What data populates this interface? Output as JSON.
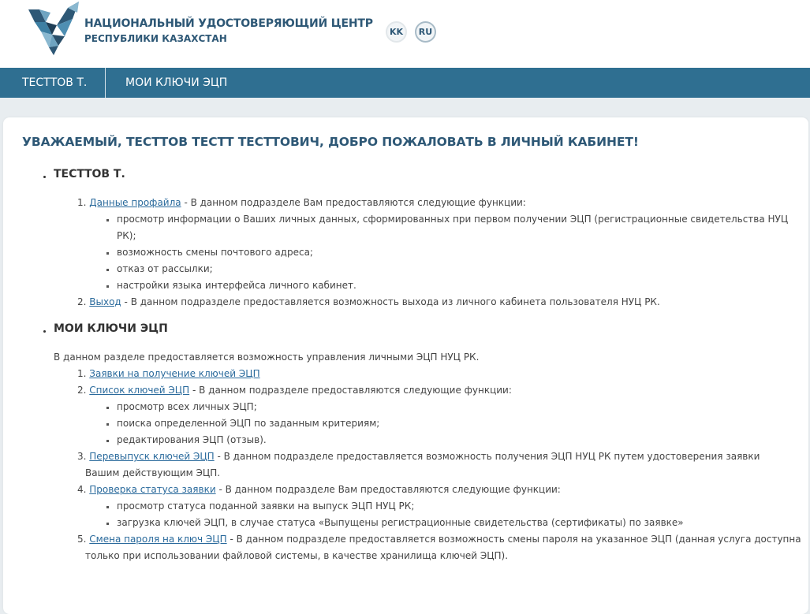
{
  "header": {
    "org_line1": "НАЦИОНАЛЬНЫЙ УДОСТОВЕРЯЮЩИЙ ЦЕНТР",
    "org_line2": "РЕСПУБЛИКИ КАЗАХСТАН",
    "lang_kk": "KK",
    "lang_ru": "RU",
    "logo_icon": "nuc-logo-icon"
  },
  "nav": {
    "user": "ТЕСТТОВ Т.",
    "keys": "МОИ КЛЮЧИ ЭЦП"
  },
  "main": {
    "welcome": "УВАЖАЕМЫЙ, ТЕСТТОВ ТЕСТТ ТЕСТТОВИЧ, ДОБРО ПОЖАЛОВАТЬ В ЛИЧНЫЙ КАБИНЕТ!",
    "section1": {
      "title": "ТЕСТТОВ Т.",
      "item1_num": "1.",
      "item1_link": "Данные профайла",
      "item1_text": " - В данном подразделе Вам предоставляются следующие функции:",
      "item1_sub1_l1": "просмотр информации о Ваших личных данных, сформированных при первом получении ЭЦП (регистрационные свидетельства НУЦ",
      "item1_sub1_l2": "РК);",
      "item1_sub2": "возможность смены почтового адреса;",
      "item1_sub3": "отказ от рассылки;",
      "item1_sub4": "настройки языка интерфейса личного кабинет.",
      "item2_num": "2.",
      "item2_link": "Выход",
      "item2_text": " - В данном подразделе предоставляется возможность выхода из личного кабинета пользователя НУЦ РК."
    },
    "section2": {
      "title": "МОИ КЛЮЧИ ЭЦП",
      "intro": "В данном разделе предоставляется возможность управления личными ЭЦП НУЦ РК.",
      "item1_num": "1.",
      "item1_link": "Заявки на получение ключей ЭЦП",
      "item2_num": "2.",
      "item2_link": "Список ключей ЭЦП",
      "item2_text": " - В данном подразделе предоставляются следующие функции:",
      "item2_sub1": "просмотр всех личных ЭЦП;",
      "item2_sub2": "поиска определенной ЭЦП по заданным критериям;",
      "item2_sub3": "редактирования ЭЦП (отзыв).",
      "item3_num": "3.",
      "item3_link": "Перевыпуск ключей ЭЦП",
      "item3_text": " - В данном подразделе предоставляется возможность получения ЭЦП НУЦ РК путем удостоверения заявки",
      "item3_text2": "Вашим действующим ЭЦП.",
      "item4_num": "4.",
      "item4_link": "Проверка статуса заявки",
      "item4_text": " - В данном подразделе Вам предоставляются следующие функции:",
      "item4_sub1": "просмотр статуса поданной заявки на выпуск ЭЦП НУЦ РК;",
      "item4_sub2": "загрузка ключей ЭЦП, в случае статуса «Выпущены регистрационные свидетельства (сертификаты) по заявке»",
      "item5_num": "5.",
      "item5_link": "Смена пароля на ключ ЭЦП",
      "item5_text": " - В данном подразделе предоставляется возможность смены пароля на указанное ЭЦП (данная услуга доступна",
      "item5_text2": "только при использовании файловой системы, в качестве хранилища ключей ЭЦП)."
    }
  }
}
